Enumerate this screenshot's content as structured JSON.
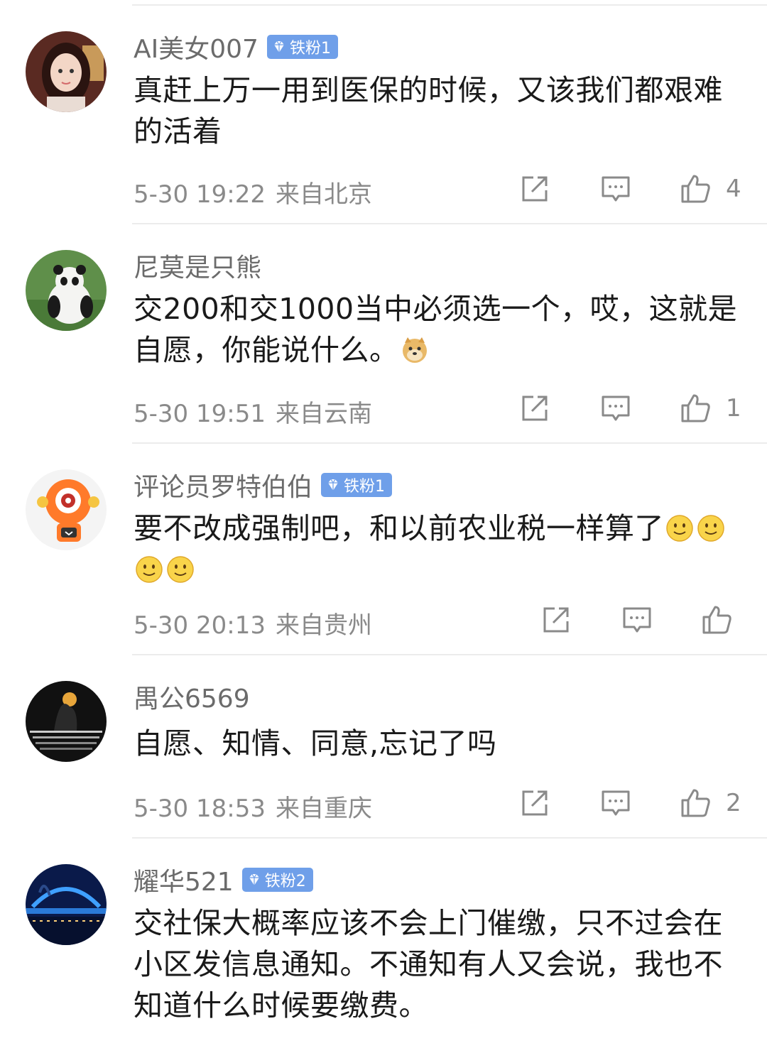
{
  "comments": [
    {
      "username": "AI美女007",
      "badge": "铁粉1",
      "text": "真赶上万一用到医保的时候，又该我们都艰难的活着",
      "time": "5-30 19:22",
      "location": "来自北京",
      "likes": "4",
      "avatar_icon": "avatar-girl"
    },
    {
      "username": "尼莫是只熊",
      "badge": "",
      "text": "交200和交1000当中必须选一个，哎，这就是自愿，你能说什么。",
      "emoji": "doge-emoji",
      "time": "5-30 19:51",
      "location": "来自云南",
      "likes": "1",
      "avatar_icon": "avatar-panda"
    },
    {
      "username": "评论员罗特伯伯",
      "badge": "铁粉1",
      "text": "要不改成强制吧，和以前农业税一样算了",
      "emoji": "smile-emoji",
      "time": "5-30 20:13",
      "location": "来自贵州",
      "likes": "",
      "avatar_icon": "avatar-robot"
    },
    {
      "username": "禺公6569",
      "badge": "",
      "text": "自愿、知情、同意,忘记了吗",
      "time": "5-30 18:53",
      "location": "来自重庆",
      "likes": "2",
      "avatar_icon": "avatar-silhouette"
    },
    {
      "username": "耀华521",
      "badge": "铁粉2",
      "text": "交社保大概率应该不会上门催缴，只不过会在小区发信息通知。不通知有人又会说，我也不知道什么时候要缴费。",
      "avatar_icon": "avatar-night-bridge"
    }
  ],
  "icons": {
    "share": "share-icon",
    "comment": "comment-icon",
    "like": "thumbs-up-icon"
  },
  "colors": {
    "badge": "#6f9fe9",
    "username": "#6b6b6b",
    "meta": "#8a8a8a",
    "divider": "#ececec"
  }
}
